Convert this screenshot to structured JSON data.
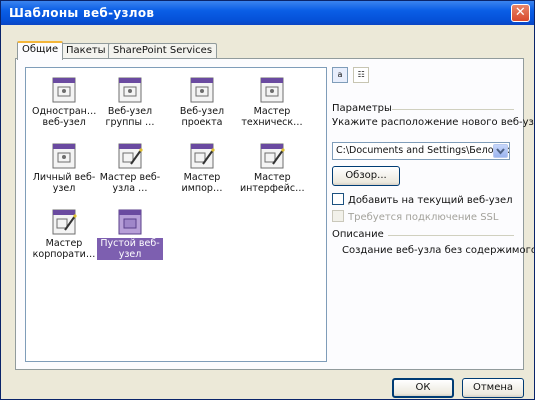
{
  "window": {
    "title": "Шаблоны веб-узлов",
    "close_glyph": "✕"
  },
  "tabs": [
    {
      "label": "Общие",
      "active": true
    },
    {
      "label": "Пакеты",
      "active": false
    },
    {
      "label": "SharePoint Services",
      "active": false
    }
  ],
  "templates": [
    {
      "label": "Одностран… веб-узел",
      "icon": "page-icon",
      "selected": false
    },
    {
      "label": "Веб-узел группы …",
      "icon": "page-icon",
      "selected": false
    },
    {
      "label": "Веб-узел проекта",
      "icon": "page-icon",
      "selected": false
    },
    {
      "label": "Мастер техническ…",
      "icon": "page-icon",
      "selected": false
    },
    {
      "label": "Личный веб-узел",
      "icon": "page-icon",
      "selected": false
    },
    {
      "label": "Мастер веб-узла …",
      "icon": "wizard-icon",
      "selected": false
    },
    {
      "label": "Мастер импор…",
      "icon": "wizard-icon",
      "selected": false
    },
    {
      "label": "Мастер интерфейс…",
      "icon": "wizard-icon",
      "selected": false
    },
    {
      "label": "Мастер корпорати…",
      "icon": "wizard-icon",
      "selected": false
    },
    {
      "label": "Пустой веб-узел",
      "icon": "blank-page-icon",
      "selected": true
    }
  ],
  "view_buttons": {
    "large_icons": "a",
    "details": "☷"
  },
  "params": {
    "group_title": "Параметры",
    "location_label": "Укажите расположение нового веб-узла:",
    "location_value": "C:\\Documents and Settings\\Белогор",
    "browse_label": "Обзор...",
    "add_to_current_label": "Добавить на текущий веб-узел",
    "ssl_label": "Требуется подключение SSL"
  },
  "description": {
    "group_title": "Описание",
    "text": "Создание веб-узла без содержимого."
  },
  "buttons": {
    "ok": "ОК",
    "cancel": "Отмена"
  },
  "colors": {
    "title_bar": "#0a5ee6",
    "selection": "#7d5fb0",
    "page_icon_border": "#6e6e6e",
    "page_icon_accent": "#6a4aa0"
  }
}
